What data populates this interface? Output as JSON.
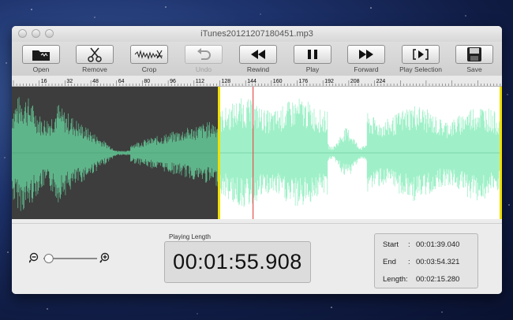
{
  "window": {
    "title": "iTunes20121207180451.mp3"
  },
  "toolbar": {
    "items": [
      {
        "label": "Open",
        "icon": "folder-icon",
        "enabled": true
      },
      {
        "label": "Remove",
        "icon": "scissors-icon",
        "enabled": true
      },
      {
        "label": "Crop",
        "icon": "crop-wave-icon",
        "enabled": true
      },
      {
        "label": "Undo",
        "icon": "undo-arrow-icon",
        "enabled": false
      },
      {
        "label": "Rewind",
        "icon": "rewind-icon",
        "enabled": true
      },
      {
        "label": "Play",
        "icon": "pause-icon",
        "enabled": true
      },
      {
        "label": "Forward",
        "icon": "fast-forward-icon",
        "enabled": true
      },
      {
        "label": "Play Selection",
        "icon": "play-selection-icon",
        "enabled": true
      },
      {
        "label": "Save",
        "icon": "save-disk-icon",
        "enabled": true
      }
    ]
  },
  "ruler": {
    "labels": [
      "16",
      "32",
      "48",
      "64",
      "80",
      "96",
      "112",
      "128",
      "144",
      "160",
      "176",
      "192",
      "208",
      "224"
    ]
  },
  "waveform": {
    "unselected_bg": "#3d3d3d",
    "unselected_wave": "#5fb58a",
    "selected_bg": "#ffffff",
    "selected_wave": "#9ff0c8",
    "marker_color": "#f0e000",
    "playhead_color": "#e35353"
  },
  "playing_length": {
    "label": "Playing Length",
    "value": "00:01:55.908"
  },
  "selection": {
    "start": {
      "label": "Start",
      "value": "00:01:39.040"
    },
    "end": {
      "label": "End",
      "value": "00:03:54.321"
    },
    "length": {
      "label": "Length:",
      "value": "00:02:15.280"
    }
  },
  "zoom": {
    "level": 0.1
  }
}
